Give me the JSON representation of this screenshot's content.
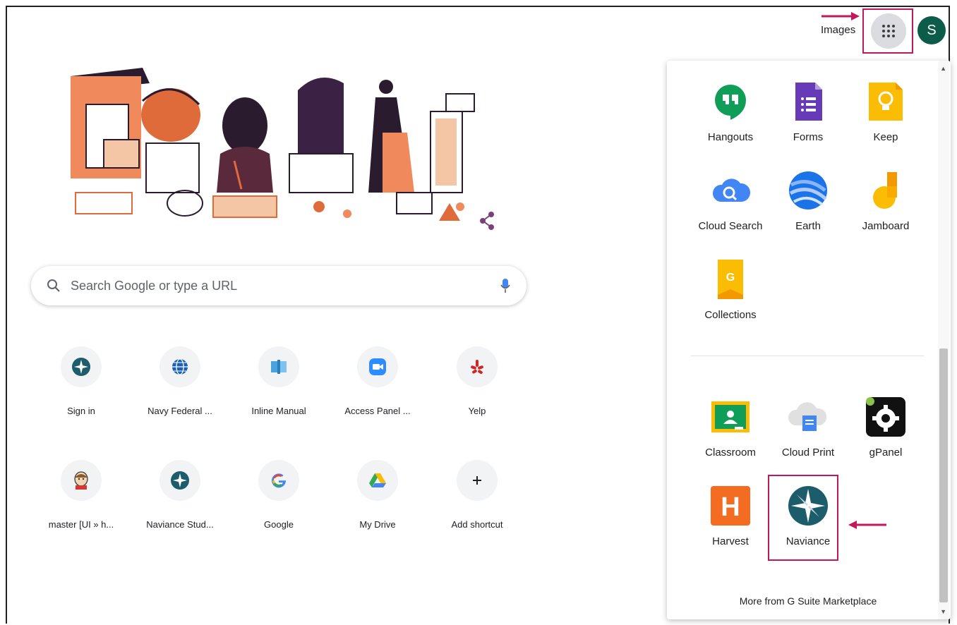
{
  "header": {
    "images_label": "Images",
    "avatar_letter": "S"
  },
  "search": {
    "placeholder": "Search Google or type a URL"
  },
  "shortcuts": [
    {
      "label": "Sign in",
      "icon": "compass-icon"
    },
    {
      "label": "Navy Federal ...",
      "icon": "globe-icon"
    },
    {
      "label": "Inline Manual",
      "icon": "book-icon"
    },
    {
      "label": "Access Panel ...",
      "icon": "zoom-icon"
    },
    {
      "label": "Yelp",
      "icon": "yelp-icon"
    },
    {
      "label": "master [UI » h...",
      "icon": "jenkins-icon"
    },
    {
      "label": "Naviance Stud...",
      "icon": "compass-icon"
    },
    {
      "label": "Google",
      "icon": "google-g-icon"
    },
    {
      "label": "My Drive",
      "icon": "drive-icon"
    },
    {
      "label": "Add shortcut",
      "icon": "plus-icon"
    }
  ],
  "apps_panel": {
    "top_apps": [
      {
        "label": "Hangouts",
        "icon": "hangouts-icon"
      },
      {
        "label": "Forms",
        "icon": "forms-icon"
      },
      {
        "label": "Keep",
        "icon": "keep-icon"
      },
      {
        "label": "Cloud Search",
        "icon": "cloud-search-icon"
      },
      {
        "label": "Earth",
        "icon": "earth-icon"
      },
      {
        "label": "Jamboard",
        "icon": "jamboard-icon"
      },
      {
        "label": "Collections",
        "icon": "collections-icon"
      }
    ],
    "bottom_apps": [
      {
        "label": "Classroom",
        "icon": "classroom-icon"
      },
      {
        "label": "Cloud Print",
        "icon": "cloud-print-icon"
      },
      {
        "label": "gPanel",
        "icon": "gpanel-icon"
      },
      {
        "label": "Harvest",
        "icon": "harvest-icon"
      },
      {
        "label": "Naviance",
        "icon": "naviance-icon"
      }
    ],
    "more_label": "More from G Suite Marketplace"
  },
  "colors": {
    "highlight": "#c2185b",
    "avatar_bg": "#0d5c4a"
  }
}
